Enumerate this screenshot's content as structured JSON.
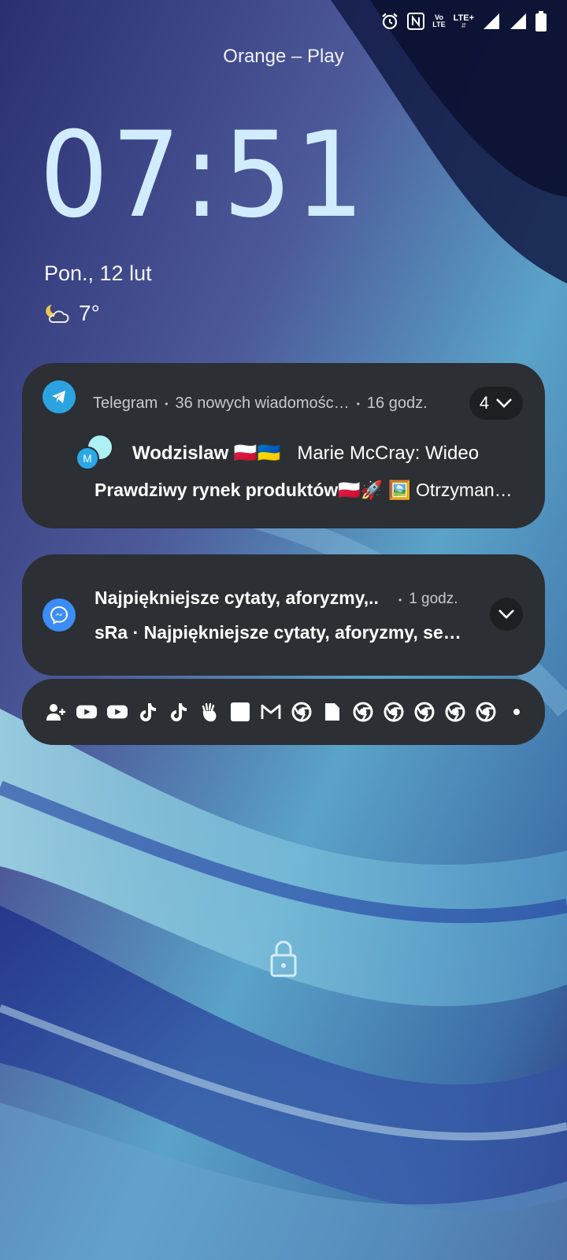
{
  "status": {
    "volte_top": "Vo",
    "volte_bottom": "LTE",
    "lte_label": "LTE+",
    "icons": [
      "alarm-icon",
      "nfc-icon",
      "volte-icon",
      "lte-plus-icon",
      "signal-icon",
      "signal-icon-2",
      "battery-icon"
    ]
  },
  "carrier": "Orange – Play",
  "clock": "07:51",
  "date": "Pon., 12 lut",
  "weather": {
    "icon": "partly-cloudy-night-icon",
    "temp": "7°"
  },
  "telegram": {
    "app": "Telegram",
    "summary": "36 nowych wiadomośc…",
    "time": "16 godz.",
    "count": "4",
    "avatar_letter": "M",
    "sender": "Wodzislaw 🇵🇱🇺🇦",
    "message": "Marie McCray: Wideo",
    "line2_bold": "Prawdziwy rynek produktów🇵🇱🚀",
    "line2_rest": " 🖼️ Otrzyman…",
    "accent": "#2aa3e0"
  },
  "messenger": {
    "title": "Najpiękniejsze cytaty, aforyzmy,..",
    "time": "1 godz.",
    "body": "sRa · Najpiękniejsze cytaty, aforyzmy, se…",
    "accent": "#3b8cf5"
  },
  "notification_icons": [
    "add-contact-icon",
    "youtube-icon",
    "youtube-icon",
    "tiktok-icon",
    "tiktok-icon",
    "hand-icon",
    "blank-square-icon",
    "gmail-icon",
    "chrome-icon",
    "file-icon",
    "chrome-icon",
    "chrome-icon",
    "chrome-icon",
    "chrome-icon",
    "chrome-icon",
    "more-dot-icon"
  ],
  "lock_icon": "lock-icon"
}
